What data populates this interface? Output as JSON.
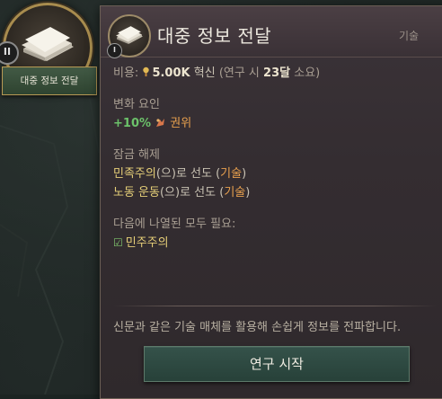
{
  "node": {
    "badge": "II",
    "label": "대중 정보 전달",
    "icon": "newspaper-stack-icon"
  },
  "tooltip": {
    "badge": "I",
    "title": "대중 정보 전달",
    "category": "기술",
    "cost": {
      "prefix": "비용:",
      "amount": "5.00K",
      "unit": "혁신",
      "research_prefix": "(연구 시",
      "months": "23달",
      "research_suffix": "소요)"
    },
    "modifiers": {
      "heading": "변화 요인",
      "value": "+10%",
      "name": "권위",
      "icon": "authority-icon"
    },
    "unlocks": {
      "heading": "잠금 해제",
      "items": [
        {
          "name": "민족주의",
          "mid": "(으)로 선도 (",
          "type": "기술",
          "end": ")"
        },
        {
          "name": "노동 운동",
          "mid": "(으)로 선도 (",
          "type": "기술",
          "end": ")"
        }
      ]
    },
    "requirements": {
      "heading": "다음에 나열된 모두 필요:",
      "items": [
        {
          "name": "민주주의",
          "met": true
        }
      ]
    },
    "description": "신문과 같은 기술 매체를 활용해 손쉽게 정보를 전파합니다.",
    "button_label": "연구 시작"
  },
  "colors": {
    "positive": "#6cc26a",
    "link": "#e8a04e",
    "highlight": "#e6cf78",
    "button": "#2e4a41",
    "frame_gold": "#a88c4e"
  }
}
